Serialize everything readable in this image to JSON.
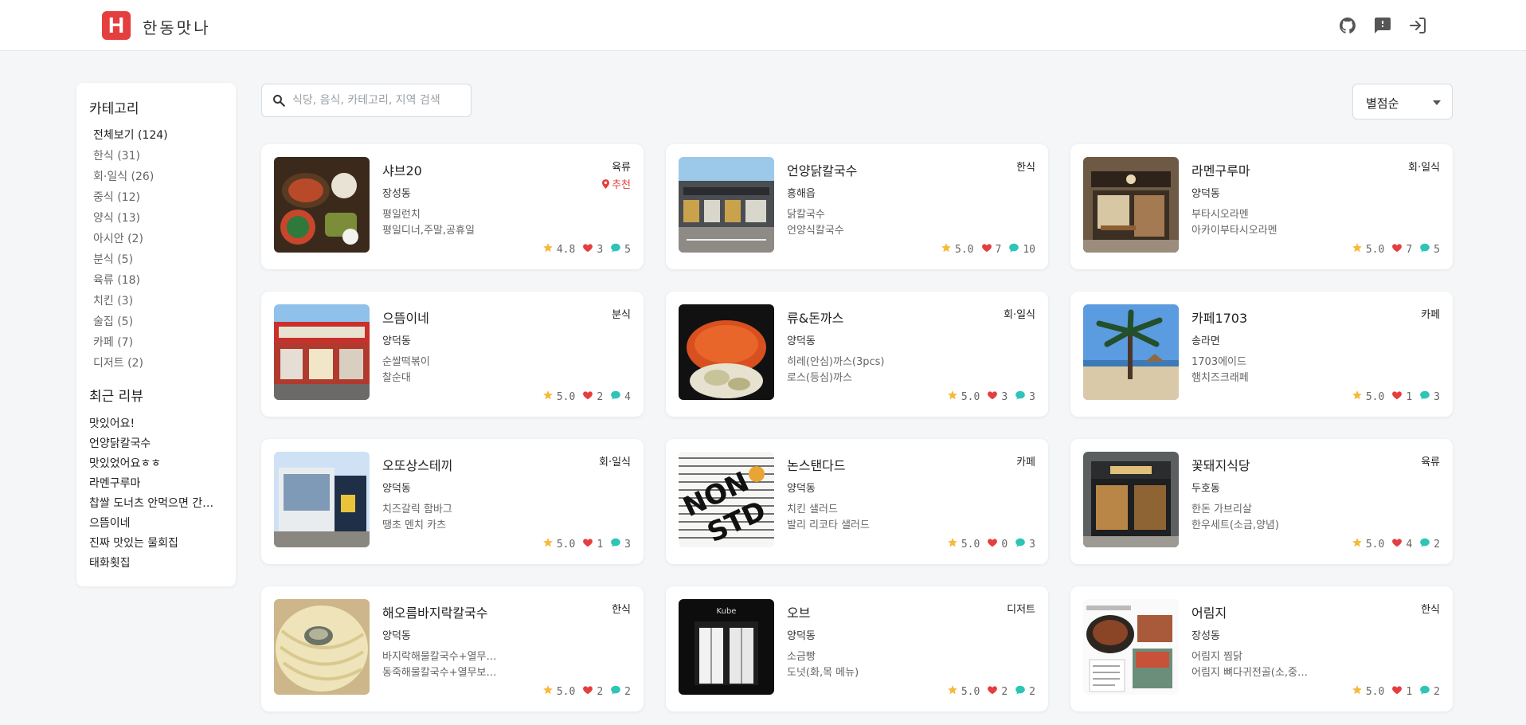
{
  "app": {
    "logo_letter": "H",
    "title": "한동맛나"
  },
  "header_icons": [
    "github-icon",
    "feedback-icon",
    "login-icon"
  ],
  "colors": {
    "brand": "#e53e3e",
    "star": "#f6b93b",
    "heart": "#e53e3e",
    "comment": "#2ec4b6"
  },
  "sidebar": {
    "categories_title": "카테고리",
    "categories": [
      "전체보기 (124)",
      "한식 (31)",
      "회·일식 (26)",
      "중식 (12)",
      "양식 (13)",
      "아시안 (2)",
      "분식 (5)",
      "육류 (18)",
      "치킨 (3)",
      "술집 (5)",
      "카페 (7)",
      "디저트 (2)"
    ],
    "reviews_title": "최근 리뷰",
    "reviews": [
      "맛있어요!",
      "언양닭칼국수",
      "맛있었어요ㅎㅎ",
      "라멘구루마",
      "찹쌀 도너츠 안먹으면 간첩 의심됨",
      "으뜸이네",
      "진짜 맛있는 물회집",
      "태화횟집"
    ]
  },
  "search": {
    "placeholder": "식당, 음식, 카테고리, 지역 검색",
    "value": ""
  },
  "sort": {
    "selected": "별점순"
  },
  "restaurants": [
    {
      "name": "샤브20",
      "region": "장성동",
      "menu": [
        "평일런치",
        "평일디너,주말,공휴일"
      ],
      "category": "육류",
      "badge": "추천",
      "rating": "4.8",
      "likes": "3",
      "comments": "5"
    },
    {
      "name": "언양닭칼국수",
      "region": "흥해읍",
      "menu": [
        "닭칼국수",
        "언양식칼국수"
      ],
      "category": "한식",
      "rating": "5.0",
      "likes": "7",
      "comments": "10"
    },
    {
      "name": "라멘구루마",
      "region": "양덕동",
      "menu": [
        "부타시오라멘",
        "아카이부타시오라멘"
      ],
      "category": "회·일식",
      "rating": "5.0",
      "likes": "7",
      "comments": "5"
    },
    {
      "name": "으뜸이네",
      "region": "양덕동",
      "menu": [
        "순쌀떡볶이",
        "찰순대"
      ],
      "category": "분식",
      "rating": "5.0",
      "likes": "2",
      "comments": "4"
    },
    {
      "name": "류&돈까스",
      "region": "양덕동",
      "menu": [
        "히레(안심)까스(3pcs)",
        "로스(등심)까스"
      ],
      "category": "회·일식",
      "rating": "5.0",
      "likes": "3",
      "comments": "3"
    },
    {
      "name": "카페1703",
      "region": "송라면",
      "menu": [
        "1703에이드",
        "햄치즈크래페"
      ],
      "category": "카페",
      "rating": "5.0",
      "likes": "1",
      "comments": "3"
    },
    {
      "name": "오또상스테끼",
      "region": "양덕동",
      "menu": [
        "치즈갈릭 함바그",
        "땡초 멘치 카츠"
      ],
      "category": "회·일식",
      "rating": "5.0",
      "likes": "1",
      "comments": "3"
    },
    {
      "name": "논스탠다드",
      "region": "양덕동",
      "menu": [
        "치킨 샐러드",
        "발리 리코타 샐러드"
      ],
      "category": "카페",
      "rating": "5.0",
      "likes": "0",
      "comments": "3"
    },
    {
      "name": "꽃돼지식당",
      "region": "두호동",
      "menu": [
        "한돈 가브리살",
        "한우세트(소금,양념)"
      ],
      "category": "육류",
      "rating": "5.0",
      "likes": "4",
      "comments": "2"
    },
    {
      "name": "해오름바지락칼국수",
      "region": "양덕동",
      "menu": [
        "바지락해물칼국수+열무보리밥",
        "동죽해물칼국수+열무보리밥"
      ],
      "category": "한식",
      "rating": "5.0",
      "likes": "2",
      "comments": "2"
    },
    {
      "name": "오브",
      "region": "양덕동",
      "menu": [
        "소금빵",
        "도넛(화,목 메뉴)"
      ],
      "category": "디저트",
      "rating": "5.0",
      "likes": "2",
      "comments": "2"
    },
    {
      "name": "어림지",
      "region": "장성동",
      "menu": [
        "어림지 찜닭",
        "어림지 뼈다귀전골(소,중,대)"
      ],
      "category": "한식",
      "rating": "5.0",
      "likes": "1",
      "comments": "2"
    }
  ]
}
